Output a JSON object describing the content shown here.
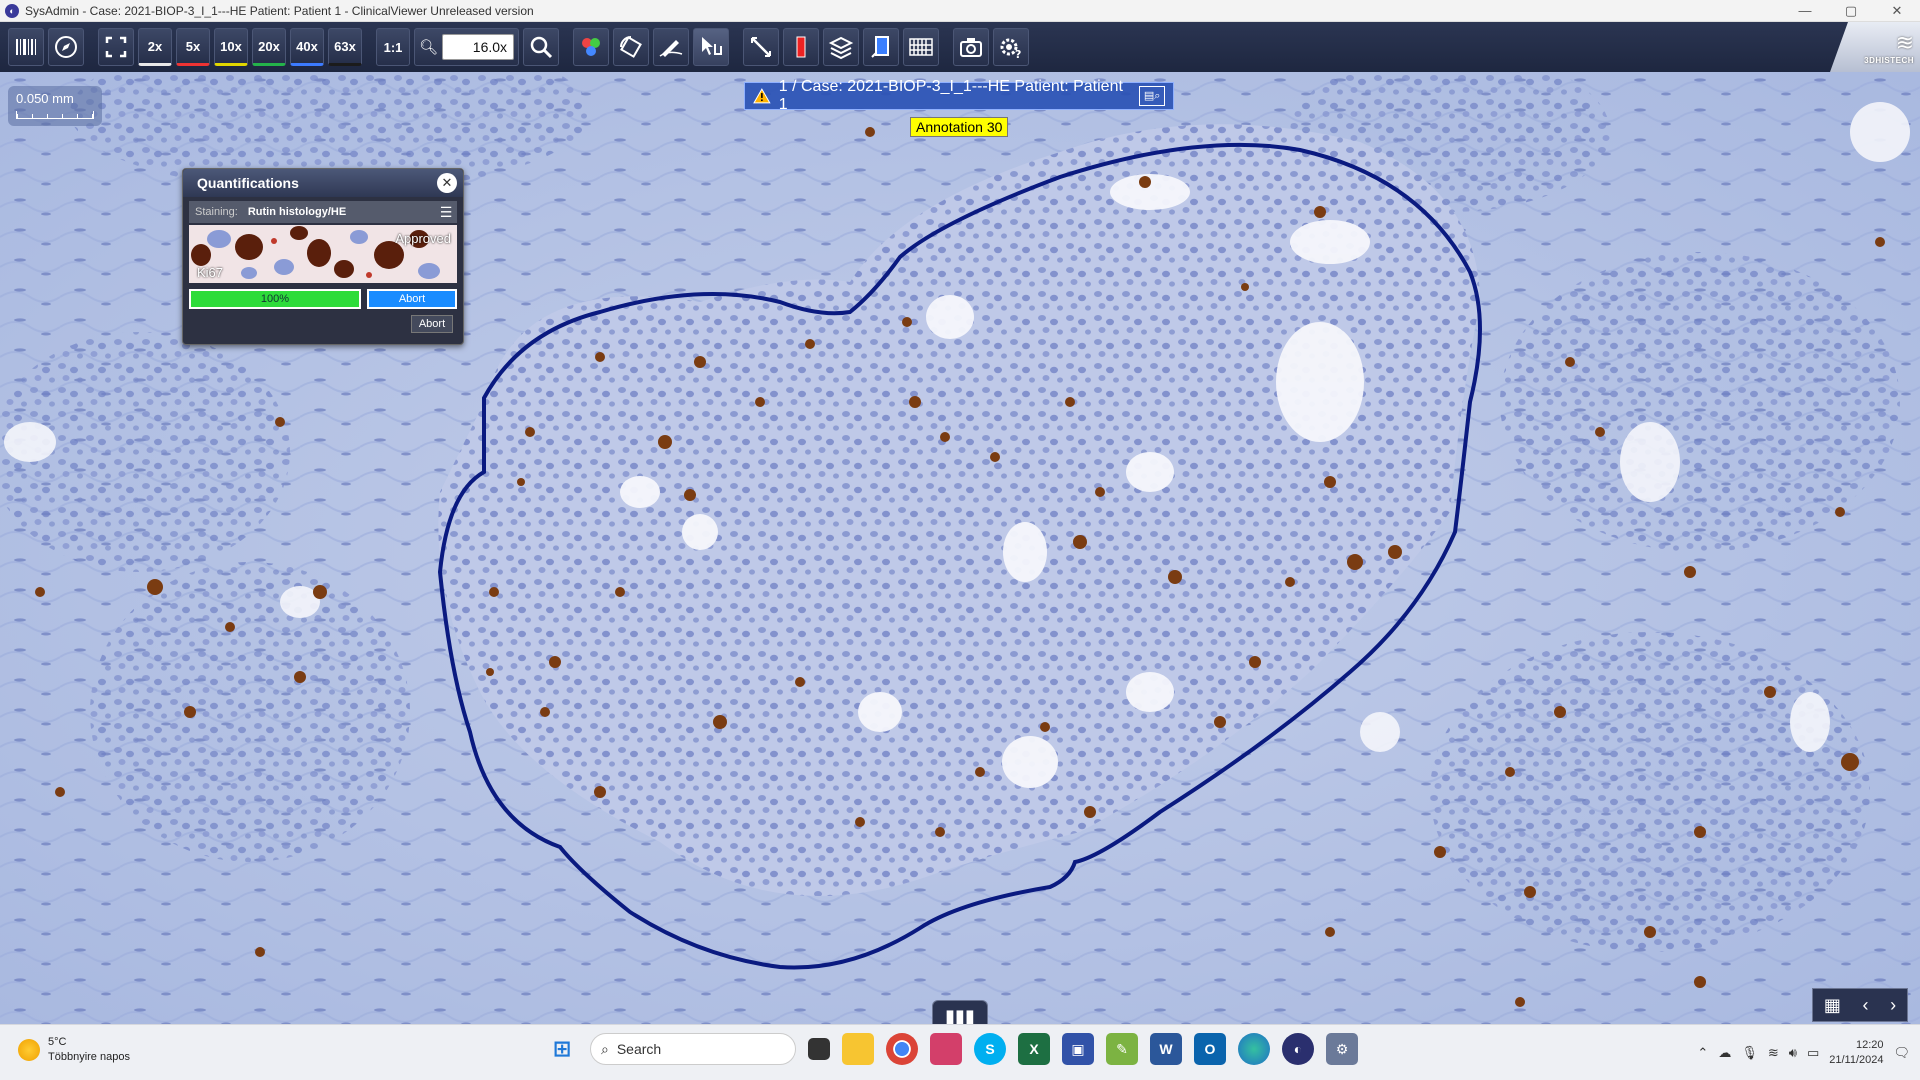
{
  "window": {
    "title": "SysAdmin - Case: 2021-BIOP-3_I_1---HE Patient: Patient 1 - ClinicalViewer Unreleased version",
    "controls": [
      "—",
      "▢",
      "✕"
    ]
  },
  "toolbar": {
    "zoom_levels": [
      "2x",
      "5x",
      "10x",
      "20x",
      "40x",
      "63x"
    ],
    "one_to_one": "1:1",
    "zoom_value": "16.0x",
    "brand": "3DHISTECH"
  },
  "viewer": {
    "scale": "0.050 mm",
    "case_banner": "1 / Case: 2021-BIOP-3_I_1---HE Patient: Patient 1",
    "annotation": "Annotation 30"
  },
  "quantifications": {
    "title": "Quantifications",
    "staining_label": "Staining:",
    "staining_value": "Rutin histology/HE",
    "thumb_status": "Approved",
    "thumb_stain": "Ki67",
    "progress_label": "100%",
    "progress_value": 1.0,
    "abort_button": "Abort",
    "abort_button2": "Abort"
  },
  "taskbar": {
    "weather_temp": "5°C",
    "weather_desc": "Többnyire napos",
    "search_placeholder": "Search",
    "time": "12:20",
    "date": "21/11/2024"
  },
  "colors": {
    "annotation_outline": "#0a1a80",
    "tissue_bg": "#b9c6e6",
    "nucleus_blue": "#6c7ec2",
    "nucleus_brown": "#7a3c12"
  }
}
